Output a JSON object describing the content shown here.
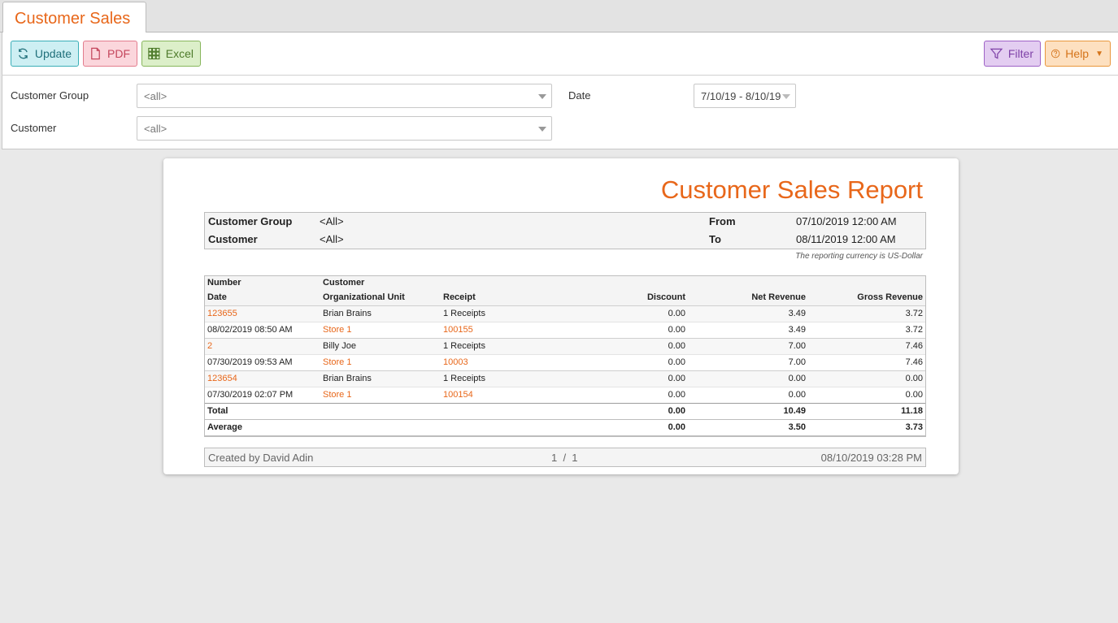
{
  "tab": {
    "title": "Customer Sales"
  },
  "toolbar": {
    "update_label": "Update",
    "pdf_label": "PDF",
    "excel_label": "Excel",
    "filter_label": "Filter",
    "help_label": "Help"
  },
  "filters": {
    "customer_group_label": "Customer Group",
    "customer_group_value": "<all>",
    "customer_label": "Customer",
    "customer_value": "<all>",
    "date_label": "Date",
    "date_value": "7/10/19 - 8/10/19"
  },
  "report": {
    "title": "Customer Sales Report",
    "header": {
      "customer_group_label": "Customer Group",
      "customer_group_value": "<All>",
      "customer_label": "Customer",
      "customer_value": "<All>",
      "from_label": "From",
      "from_value": "07/10/2019 12:00 AM",
      "to_label": "To",
      "to_value": "08/11/2019 12:00 AM"
    },
    "currency_note": "The reporting currency is US-Dollar",
    "columns": {
      "number": "Number",
      "customer": "Customer",
      "date": "Date",
      "org_unit": "Organizational Unit",
      "receipt": "Receipt",
      "discount": "Discount",
      "net_revenue": "Net Revenue",
      "gross_revenue": "Gross Revenue"
    },
    "groups": [
      {
        "number": "123655",
        "customer": "Brian Brains",
        "receipts": "1 Receipts",
        "discount": "0.00",
        "net": "3.49",
        "gross": "3.72",
        "detail": {
          "date": "08/02/2019 08:50 AM",
          "unit": "Store 1",
          "receipt": "100155",
          "discount": "0.00",
          "net": "3.49",
          "gross": "3.72"
        }
      },
      {
        "number": "2",
        "customer": "Billy Joe",
        "receipts": "1 Receipts",
        "discount": "0.00",
        "net": "7.00",
        "gross": "7.46",
        "detail": {
          "date": "07/30/2019 09:53 AM",
          "unit": "Store 1",
          "receipt": "10003",
          "discount": "0.00",
          "net": "7.00",
          "gross": "7.46"
        }
      },
      {
        "number": "123654",
        "customer": "Brian Brains",
        "receipts": "1 Receipts",
        "discount": "0.00",
        "net": "0.00",
        "gross": "0.00",
        "detail": {
          "date": "07/30/2019 02:07 PM",
          "unit": "Store 1",
          "receipt": "100154",
          "discount": "0.00",
          "net": "0.00",
          "gross": "0.00"
        }
      }
    ],
    "total": {
      "label": "Total",
      "discount": "0.00",
      "net": "10.49",
      "gross": "11.18"
    },
    "average": {
      "label": "Average",
      "discount": "0.00",
      "net": "3.50",
      "gross": "3.73"
    },
    "footer": {
      "created_by": "Created by David Adin",
      "page": "1  /  1",
      "timestamp": "08/10/2019 03:28 PM"
    }
  },
  "colors": {
    "accent": "#e8671a"
  },
  "icons": [
    "refresh-icon",
    "pdf-file-icon",
    "grid-icon",
    "filter-icon",
    "help-circle-icon"
  ]
}
